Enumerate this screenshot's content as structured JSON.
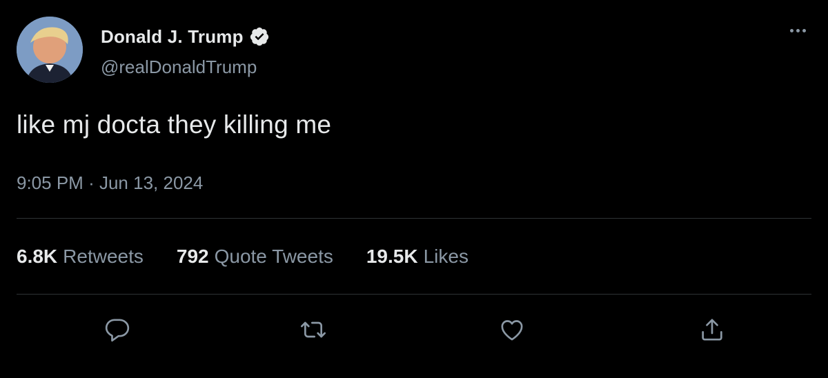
{
  "tweet": {
    "author": {
      "display_name": "Donald J. Trump",
      "handle": "@realDonaldTrump",
      "verified": true,
      "avatar": "profile-photo"
    },
    "text": "like mj docta they killing me",
    "time": "9:05 PM",
    "separator": "·",
    "date": "Jun 13, 2024",
    "stats": [
      {
        "value": "6.8K",
        "label": "Retweets"
      },
      {
        "value": "792",
        "label": "Quote Tweets"
      },
      {
        "value": "19.5K",
        "label": "Likes"
      }
    ],
    "actions": [
      {
        "icon": "reply-icon"
      },
      {
        "icon": "retweet-icon"
      },
      {
        "icon": "like-icon"
      },
      {
        "icon": "share-icon"
      }
    ],
    "more_icon": "more-options-icon"
  },
  "colors": {
    "background": "#000000",
    "primary_text": "#e7e9ea",
    "secondary_text": "#8b98a5",
    "divider": "#2f3336"
  }
}
